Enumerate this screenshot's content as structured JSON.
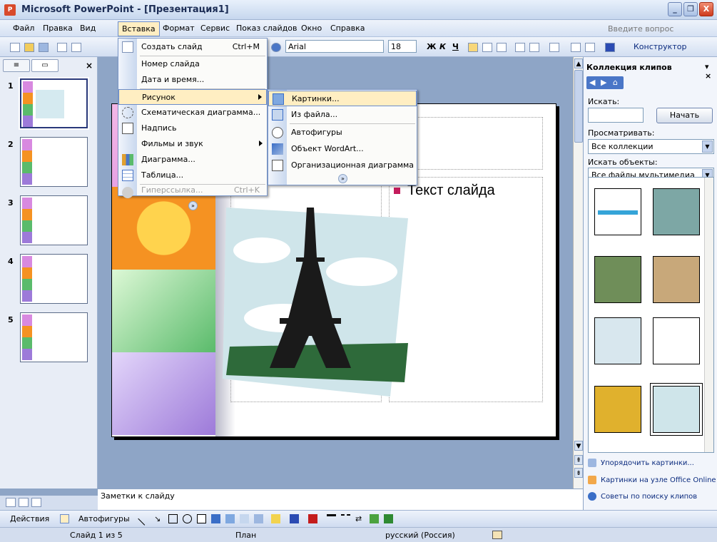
{
  "window": {
    "title": "Microsoft PowerPoint - [Презентация1]",
    "app_icon": "powerpoint-icon",
    "buttons": [
      "_",
      "❐",
      "X"
    ]
  },
  "menubar": {
    "items": [
      "Файл",
      "Правка",
      "Вид",
      "Вставка",
      "Формат",
      "Сервис",
      "Показ слайдов",
      "Окно",
      "Справка"
    ],
    "active": "Вставка",
    "ask_placeholder": "Введите вопрос"
  },
  "toolbar": {
    "font_name": "Arial",
    "font_size": "18",
    "bold": "Ж",
    "italic": "К",
    "underline": "Ч",
    "designer": "Конструктор"
  },
  "insert_menu": {
    "items": [
      {
        "label": "Создать слайд",
        "shortcut": "Ctrl+M",
        "icon": "new-slide-icon"
      },
      {
        "label": "Номер слайда",
        "shortcut": "",
        "icon": ""
      },
      {
        "label": "Дата и время...",
        "shortcut": "",
        "icon": ""
      },
      {
        "label": "Рисунок",
        "shortcut": "",
        "icon": "",
        "submenu": true
      },
      {
        "label": "Схематическая диаграмма...",
        "shortcut": "",
        "icon": "diagram-icon"
      },
      {
        "label": "Надпись",
        "shortcut": "",
        "icon": "textbox-icon"
      },
      {
        "label": "Фильмы и звук",
        "shortcut": "",
        "icon": "",
        "submenu": true
      },
      {
        "label": "Диаграмма...",
        "shortcut": "",
        "icon": "chart-icon"
      },
      {
        "label": "Таблица...",
        "shortcut": "",
        "icon": "table-icon"
      },
      {
        "label": "Гиперссылка...",
        "shortcut": "Ctrl+K",
        "icon": "hyperlink-icon",
        "disabled": true
      }
    ]
  },
  "picture_submenu": {
    "items": [
      {
        "label": "Картинки...",
        "icon": "clipart-icon"
      },
      {
        "label": "Из файла...",
        "icon": "from-file-icon"
      },
      {
        "label": "Автофигуры",
        "icon": "autoshapes-icon"
      },
      {
        "label": "Объект WordArt...",
        "icon": "wordart-icon"
      },
      {
        "label": "Организационная диаграмма",
        "icon": "org-chart-icon"
      }
    ]
  },
  "slides": {
    "numbers": [
      "1",
      "2",
      "3",
      "4",
      "5"
    ],
    "selected": 1
  },
  "slide": {
    "body_text": "Текст слайда",
    "bullet_color": "#C41C5C"
  },
  "notes": {
    "placeholder": "Заметки к слайду"
  },
  "taskpane": {
    "title": "Коллекция клипов",
    "search_label": "Искать:",
    "search_value": "",
    "search_button": "Начать",
    "browse_label": "Просматривать:",
    "browse_value": "Все коллекции",
    "objects_label": "Искать объекты:",
    "objects_value": "Все файлы мультимедиа",
    "links": [
      {
        "text": "Упорядочить картинки...",
        "icon": "organize-clips-icon"
      },
      {
        "text": "Картинки на узле Office Online",
        "icon": "office-online-icon"
      },
      {
        "text": "Советы по поиску клипов",
        "icon": "help-icon"
      }
    ]
  },
  "drawbar": {
    "actions": "Действия",
    "autoshapes": "Автофигуры"
  },
  "statusbar": {
    "slide": "Слайд 1 из 5",
    "design": "План",
    "language": "русский (Россия)"
  },
  "colors": {
    "accent": "#FFEEC2",
    "workspace": "#8EA5C6",
    "bullet": "#C41C5C"
  }
}
